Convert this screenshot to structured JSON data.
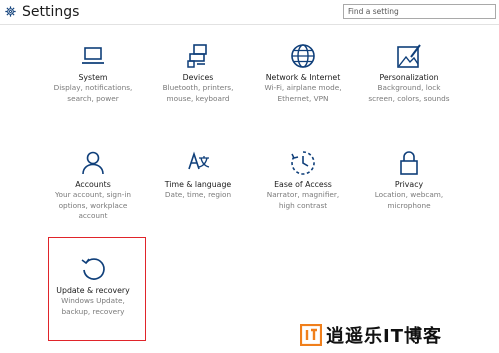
{
  "window": {
    "title": "Settings"
  },
  "search": {
    "placeholder": "Find a setting"
  },
  "tiles": [
    {
      "name": "System",
      "desc": [
        "Display, notifications,",
        "search, power"
      ]
    },
    {
      "name": "Devices",
      "desc": [
        "Bluetooth, printers,",
        "mouse, keyboard"
      ]
    },
    {
      "name": "Network & Internet",
      "desc": [
        "Wi-Fi, airplane mode,",
        "Ethernet, VPN"
      ]
    },
    {
      "name": "Personalization",
      "desc": [
        "Background, lock",
        "screen, colors, sounds"
      ]
    },
    {
      "name": "Accounts",
      "desc": [
        "Your account, sign-in",
        "options, workplace",
        "account"
      ]
    },
    {
      "name": "Time & language",
      "desc": [
        "Date, time, region"
      ]
    },
    {
      "name": "Ease of Access",
      "desc": [
        "Narrator, magnifier,",
        "high contrast"
      ]
    },
    {
      "name": "Privacy",
      "desc": [
        "Location, webcam,",
        "microphone"
      ]
    },
    {
      "name": "Update & recovery",
      "desc": [
        "Windows Update,",
        "backup, recovery"
      ]
    }
  ],
  "watermark": {
    "text": "逍遥乐IT博客"
  },
  "colors": {
    "accent": "#0f3f7a",
    "highlight": "#e0242a",
    "watermark_orange": "#f07f1b"
  }
}
